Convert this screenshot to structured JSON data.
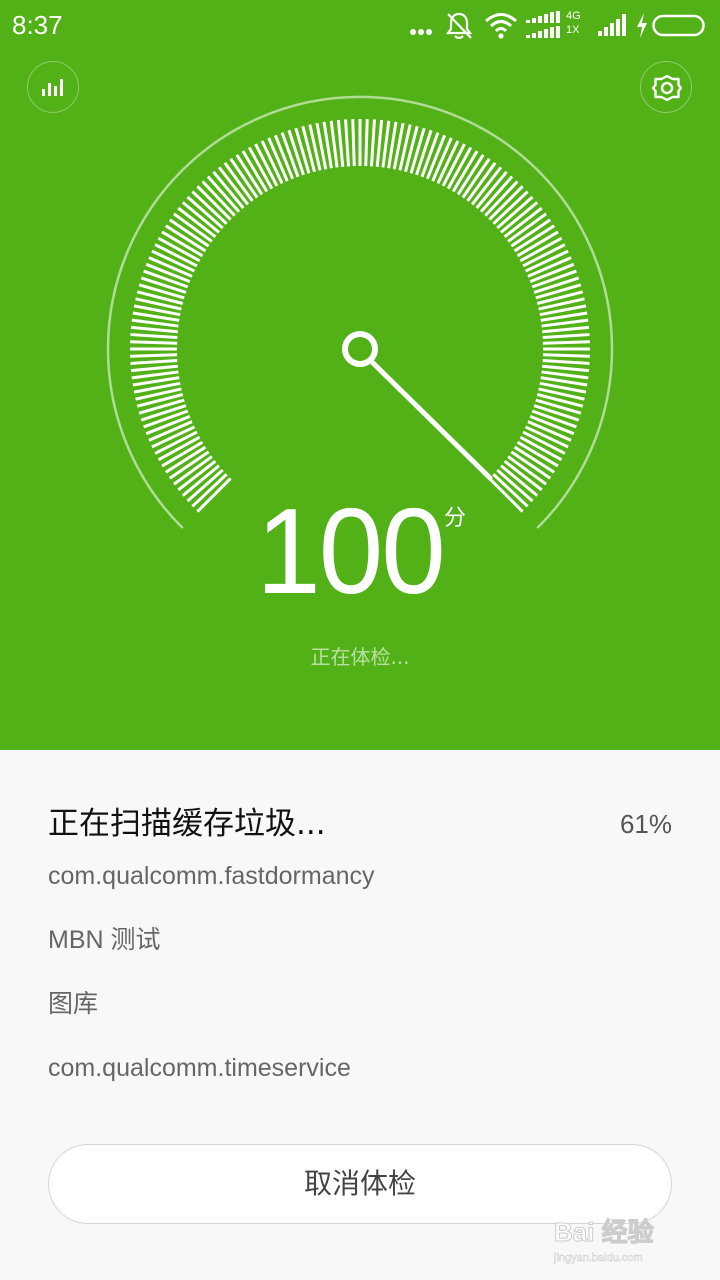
{
  "status_bar": {
    "time": "8:37",
    "network_top": "4G",
    "network_bottom": "1X",
    "icons": [
      "more-dots-icon",
      "notification-muted-icon",
      "wifi-icon",
      "signal-4g-icon",
      "signal-icon",
      "charging-icon",
      "battery-icon"
    ]
  },
  "header": {
    "left_icon": "bar-chart-icon",
    "right_icon": "gear-icon"
  },
  "gauge": {
    "score": "100",
    "unit": "分",
    "status": "正在体检..."
  },
  "scan": {
    "title": "正在扫描缓存垃圾...",
    "percent": "61%",
    "items": [
      "com.qualcomm.fastdormancy",
      "MBN 测试",
      "图库",
      "com.qualcomm.timeservice"
    ]
  },
  "actions": {
    "cancel_label": "取消体检"
  },
  "watermark": {
    "brand_text": "Bai 经验",
    "url_text": "jingyan.baidu.com"
  },
  "colors": {
    "primary_green": "#52b117",
    "background": "#f8f8f8"
  }
}
